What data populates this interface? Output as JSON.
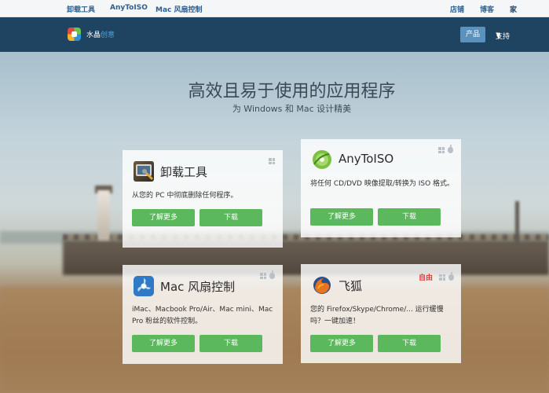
{
  "topbar": {
    "links": [
      "卸载工具",
      "AnyToISO",
      "Mac 风扇控制"
    ],
    "right_links": [
      "店铺",
      "博客",
      "家"
    ]
  },
  "header": {
    "brand_main": "水晶",
    "brand_accent": "创意",
    "products_label": "产品",
    "support_label": "支持"
  },
  "hero": {
    "title": "高效且易于使用的应用程序",
    "subtitle": "为 Windows 和 Mac 设计精美"
  },
  "cards": [
    {
      "name": "卸载工具",
      "icon": "uninstaller-icon",
      "platforms": [
        "windows"
      ],
      "description": "从您的 PC 中彻底删除任何程序。",
      "learn_more": "了解更多",
      "download": "下载"
    },
    {
      "name": "AnyToISO",
      "icon": "anytoiso-disc-icon",
      "platforms": [
        "windows",
        "mac"
      ],
      "description": "将任何 CD/DVD 映像提取/转换为 ISO 格式。",
      "learn_more": "了解更多",
      "download": "下载"
    },
    {
      "name": "Mac 风扇控制",
      "icon": "fan-icon",
      "platforms": [
        "windows",
        "mac"
      ],
      "description": "iMac、Macbook Pro/Air、Mac mini、Mac Pro 粉丝的软件控制。",
      "learn_more": "了解更多",
      "download": "下载"
    },
    {
      "name": "飞狐",
      "icon": "firefox-icon",
      "platforms": [
        "windows",
        "mac"
      ],
      "badge": "自由",
      "description": "您的 Firefox/Skype/Chrome/... 运行缓慢吗？一键加速！",
      "learn_more": "了解更多",
      "download": "下载"
    }
  ],
  "colors": {
    "header_bg": "#1f4461",
    "button_green": "#5cb85c",
    "accent_blue": "#5b91bd",
    "free_badge": "#e03b3b"
  }
}
